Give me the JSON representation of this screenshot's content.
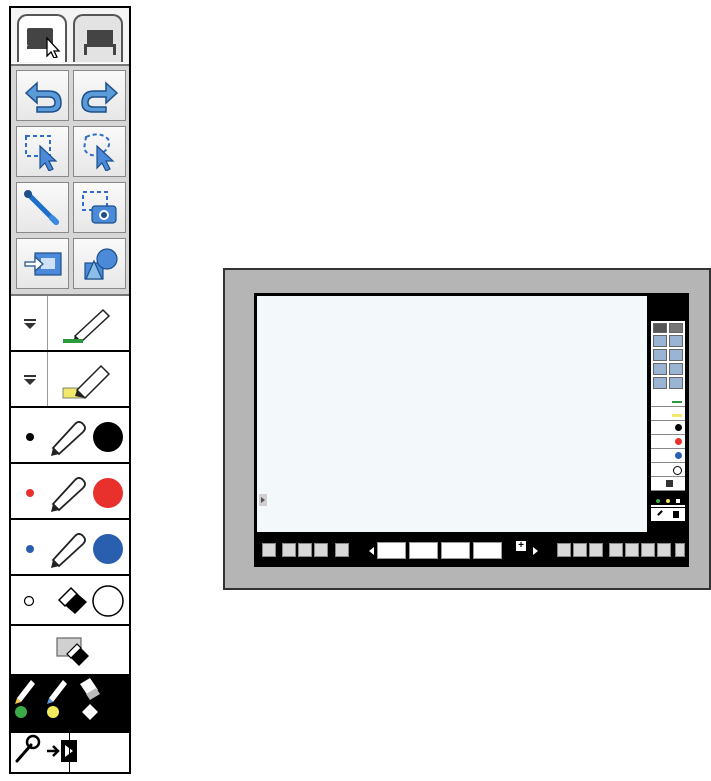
{
  "toolbar": {
    "tabs": [
      {
        "icon": "pointer-mode-icon",
        "active": true
      },
      {
        "icon": "whiteboard-mode-icon",
        "active": false
      }
    ],
    "buttons": [
      {
        "icon": "undo-icon"
      },
      {
        "icon": "redo-icon"
      },
      {
        "icon": "rectangle-select-icon"
      },
      {
        "icon": "freeform-select-icon"
      },
      {
        "icon": "pen-stroke-icon"
      },
      {
        "icon": "screen-capture-icon"
      },
      {
        "icon": "insert-image-icon"
      },
      {
        "icon": "shapes-icon"
      }
    ],
    "pen_rows": [
      {
        "type": "pen",
        "indicator": "dropdown",
        "color": "#2a9a3c"
      },
      {
        "type": "highlighter",
        "indicator": "dropdown",
        "color": "#f2e96a"
      },
      {
        "type": "pen",
        "indicator": "dot",
        "color": "#000000"
      },
      {
        "type": "pen",
        "indicator": "dot",
        "color": "#e8312d"
      },
      {
        "type": "pen",
        "indicator": "dot",
        "color": "#2a5fb0"
      },
      {
        "type": "eraser",
        "indicator": "circle",
        "color": "#ffffff"
      }
    ],
    "clear_button": {
      "icon": "clear-page-icon"
    },
    "quick_tools": [
      {
        "icon": "green-pen-icon",
        "color": "#3bab4a"
      },
      {
        "icon": "yellow-highlighter-icon",
        "color": "#f0ea5e"
      },
      {
        "icon": "eraser-icon",
        "color": "#ffffff"
      }
    ],
    "bottom_buttons": [
      {
        "icon": "settings-wrench-icon"
      },
      {
        "icon": "exit-icon"
      }
    ]
  },
  "whiteboard": {
    "frame_color": "#b5b5b5",
    "canvas_color": "#f3f8fb",
    "page_add_label": "+"
  }
}
